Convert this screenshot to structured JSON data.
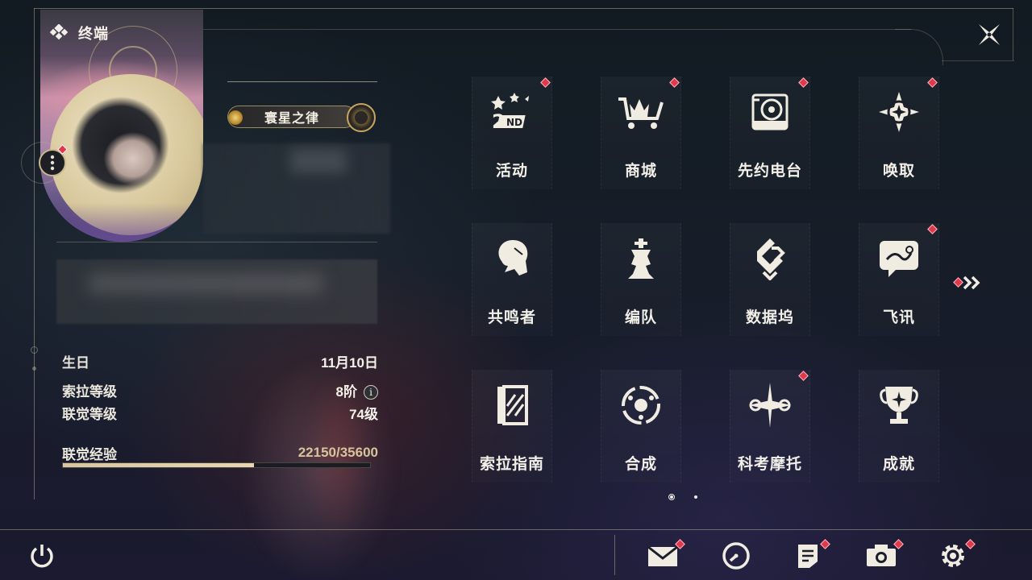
{
  "header": {
    "title": "终端"
  },
  "profile": {
    "title_plate": "寰星之律",
    "stats": [
      {
        "label": "生日",
        "value": "11月10日"
      },
      {
        "label": "索拉等级",
        "value": "8阶"
      },
      {
        "label": "联觉等级",
        "value": "74级"
      }
    ],
    "exp": {
      "label": "联觉经验",
      "value": "22150/35600",
      "fraction": 0.622
    }
  },
  "grid": [
    {
      "label": "活动",
      "icon": "2nd-anniversary-icon",
      "badge": true
    },
    {
      "label": "商城",
      "icon": "shop-cart-icon",
      "badge": true
    },
    {
      "label": "先约电台",
      "icon": "radio-icon",
      "badge": true
    },
    {
      "label": "唤取",
      "icon": "compass-star-icon",
      "badge": true
    },
    {
      "label": "共鸣者",
      "icon": "resonator-head-icon",
      "badge": false
    },
    {
      "label": "编队",
      "icon": "chess-king-icon",
      "badge": false
    },
    {
      "label": "数据坞",
      "icon": "data-bank-icon",
      "badge": false
    },
    {
      "label": "飞讯",
      "icon": "chat-bubble-icon",
      "badge": true
    },
    {
      "label": "索拉指南",
      "icon": "guide-book-icon",
      "badge": false
    },
    {
      "label": "合成",
      "icon": "synthesis-icon",
      "badge": false
    },
    {
      "label": "科考摩托",
      "icon": "motorbike-icon",
      "badge": true
    },
    {
      "label": "成就",
      "icon": "trophy-icon",
      "badge": false
    }
  ],
  "pagination": {
    "current": 1,
    "total": 2
  },
  "bottom_bar": [
    {
      "name": "power-icon"
    },
    {
      "name": "mail-icon",
      "badge": true
    },
    {
      "name": "clock-icon",
      "badge": false
    },
    {
      "name": "notice-icon",
      "badge": true
    },
    {
      "name": "camera-icon",
      "badge": true
    },
    {
      "name": "settings-icon",
      "badge": true
    }
  ],
  "colors": {
    "accent_gold": "#c8b88a",
    "badge_red": "#e0394c",
    "exp_fill": "#d9c6a0"
  }
}
